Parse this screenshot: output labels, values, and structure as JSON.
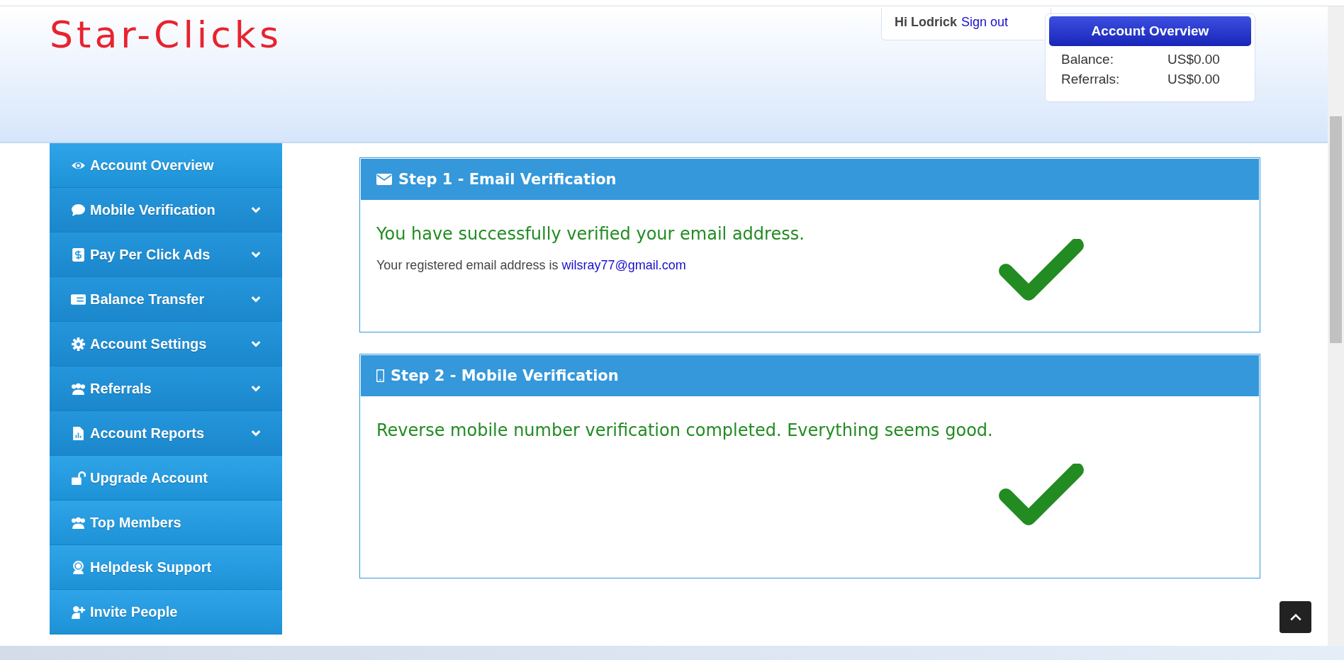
{
  "header": {
    "logo": "Star-Clicks",
    "greeting": "Hi Lodrick",
    "sign_out": "Sign out"
  },
  "account_overview": {
    "title": "Account Overview",
    "rows": [
      {
        "label": "Balance:",
        "value": "US$0.00"
      },
      {
        "label": "Referrals:",
        "value": "US$0.00"
      }
    ]
  },
  "sidebar": {
    "items": [
      {
        "label": "Account Overview",
        "expandable": false
      },
      {
        "label": "Mobile Verification",
        "expandable": true
      },
      {
        "label": "Pay Per Click Ads",
        "expandable": true
      },
      {
        "label": "Balance Transfer",
        "expandable": true
      },
      {
        "label": "Account Settings",
        "expandable": true
      },
      {
        "label": "Referrals",
        "expandable": true
      },
      {
        "label": "Account Reports",
        "expandable": true
      },
      {
        "label": "Upgrade Account",
        "expandable": false
      },
      {
        "label": "Top Members",
        "expandable": false
      },
      {
        "label": "Helpdesk Support",
        "expandable": false
      },
      {
        "label": "Invite People",
        "expandable": false
      }
    ]
  },
  "panels": [
    {
      "title": "Step 1 - Email Verification",
      "message": "You have successfully verified your email address.",
      "detail": "Your registered email address is",
      "email": "wilsray77@gmail.com",
      "verified": true
    },
    {
      "title": "Step 2 - Mobile Verification",
      "message": "Reverse mobile number verification completed. Everything seems good.",
      "verified": true
    }
  ]
}
